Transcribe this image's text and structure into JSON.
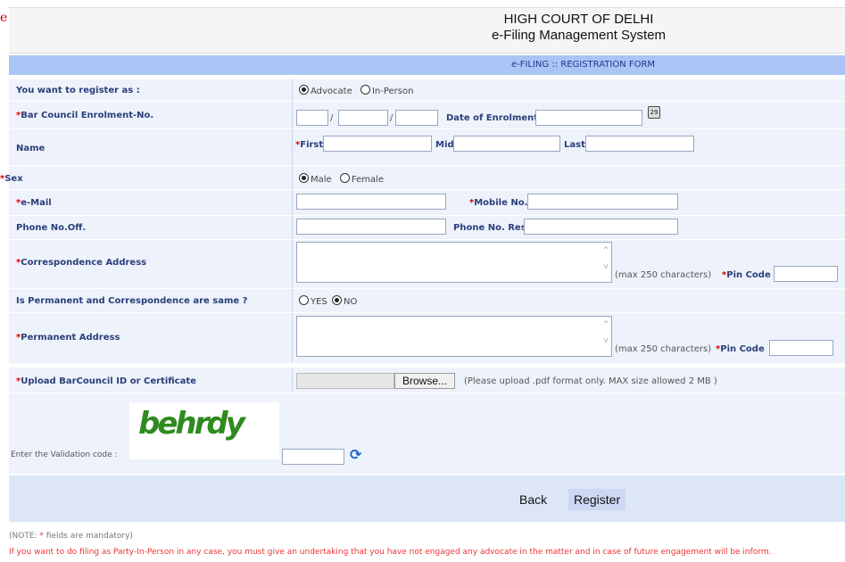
{
  "edge_char": "e",
  "header": {
    "line1": "HIGH COURT OF DELHI",
    "line2": "e-Filing Management System"
  },
  "form_title": "e-FILING :: REGISTRATION FORM",
  "register_as": {
    "label": "You want to register as :",
    "opt1": "Advocate",
    "opt2": "In-Person",
    "selected": "Advocate"
  },
  "bar_council": {
    "label": "Bar Council Enrolment-No.",
    "date_label": "Date of Enrolment",
    "sep": "/",
    "cal_icon": "calendar-icon"
  },
  "name": {
    "label": "Name",
    "first": "First",
    "mid": "Mid",
    "last": "Last"
  },
  "sex": {
    "label": "Sex",
    "opt1": "Male",
    "opt2": "Female",
    "selected": "Male"
  },
  "email": {
    "label": "e-Mail",
    "mobile_label": "Mobile No."
  },
  "phone": {
    "label": "Phone No.Off.",
    "res_label": "Phone No. Res."
  },
  "corr_address": {
    "label": "Correspondence Address",
    "hint": "(max 250 characters)",
    "pin_label": "Pin Code"
  },
  "same_address": {
    "label": "Is Permanent and Correspondence are same ?",
    "opt1": "YES",
    "opt2": "NO",
    "selected": "NO"
  },
  "perm_address": {
    "label": "Permanent Address",
    "hint": "(max 250 characters)",
    "pin_label": "Pin Code"
  },
  "upload": {
    "label": "Upload BarCouncil ID or Certificate",
    "browse": "Browse...",
    "hint": "(Please upload .pdf format only. MAX size allowed 2 MB )"
  },
  "captcha": {
    "label": "Enter the Validation code :",
    "code": "behrdy",
    "refresh_icon": "refresh-icon"
  },
  "actions": {
    "back": "Back",
    "register": "Register"
  },
  "notes": {
    "mandatory_prefix": "(NOTE: ",
    "mandatory_star": "*",
    "mandatory_text": " fields are mandatory)",
    "party_in_person": "If you want to do filing as Party-In-Person in any case, you must give an undertaking that you have not engaged any advocate in the matter and in case of future engagement will be inform."
  },
  "colors": {
    "accent": "#a9c4f5",
    "row_bg": "#eef2fb",
    "required": "#dd0000"
  }
}
